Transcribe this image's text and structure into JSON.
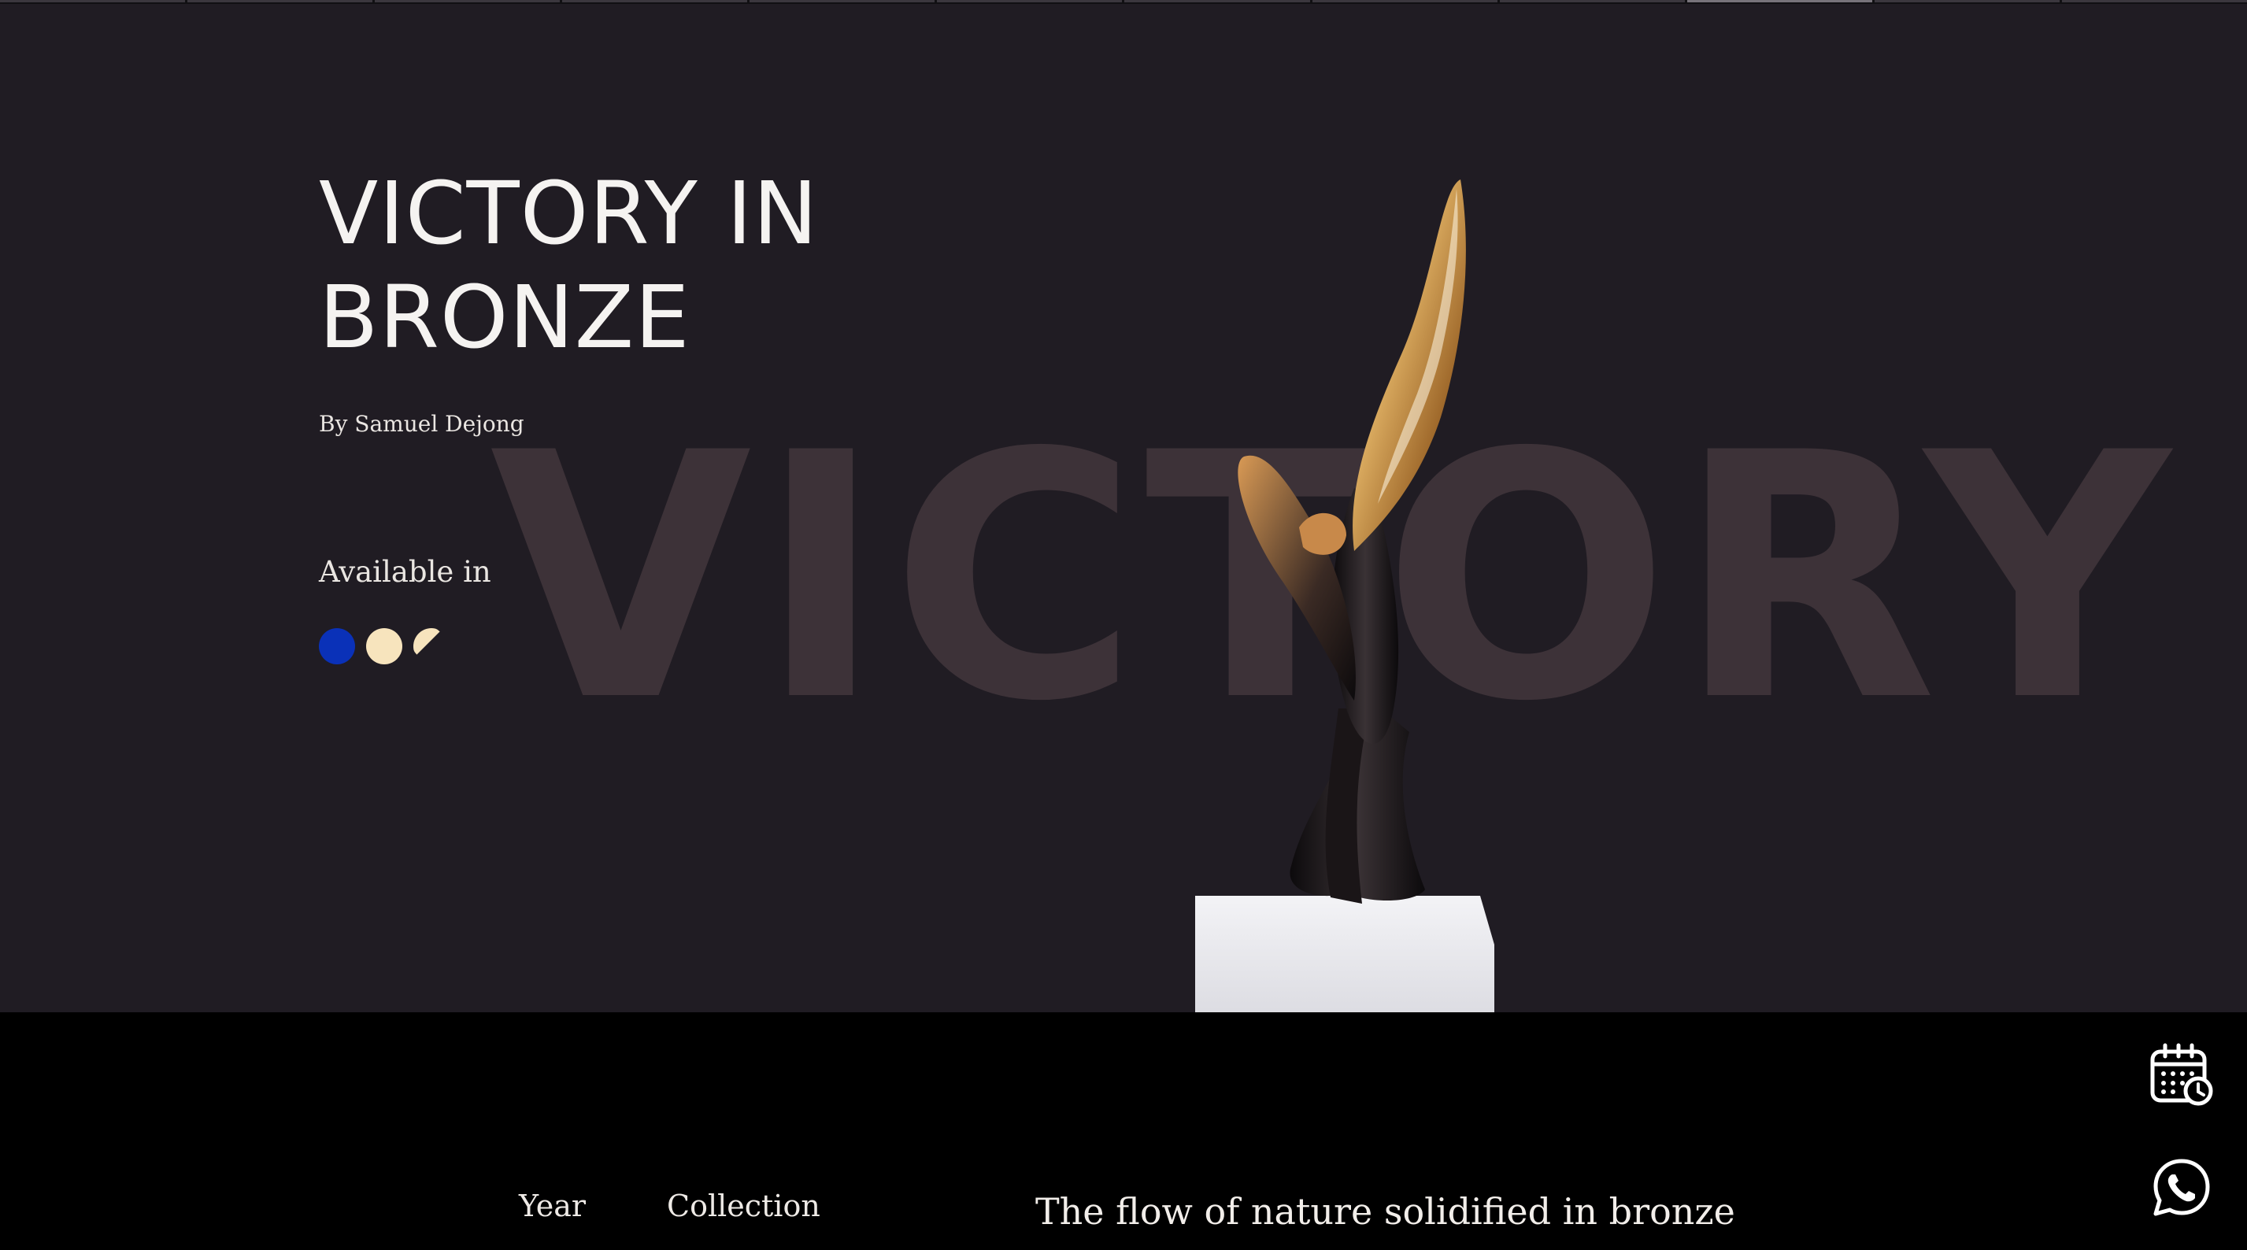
{
  "hero": {
    "background_word": "VICTORY",
    "title_line1": "VICTORY IN",
    "title_line2": "BRONZE",
    "byline": "By Samuel Dejong",
    "available_label": "Available in",
    "swatches": [
      {
        "name": "blue",
        "color": "#0a31b8"
      },
      {
        "name": "cream",
        "color": "#f7e4bd"
      },
      {
        "name": "half-cream",
        "color": "#f7e4bd"
      }
    ],
    "progress_segments": 12,
    "active_segment": 9
  },
  "details": {
    "year_label": "Year",
    "collection_label": "Collection",
    "tagline": "The flow of nature solidified in bronze"
  },
  "floating_actions": {
    "calendar_icon": "calendar-clock-icon",
    "whatsapp_icon": "whatsapp-icon"
  },
  "colors": {
    "hero_bg": "#201c23",
    "bg_word": "#3d3238",
    "footer_bg": "#000000",
    "text": "#f5f3f1"
  }
}
